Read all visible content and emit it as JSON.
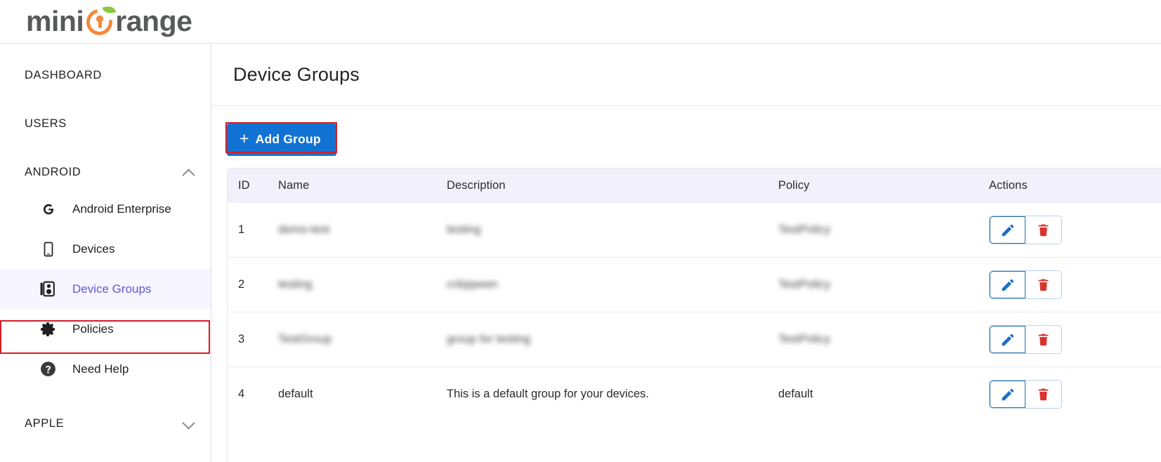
{
  "brand": {
    "logo_text_1": "mini",
    "logo_text_2": "range",
    "logo_alt": "miniOrange",
    "orange_hex": "#f6883a",
    "leaf_hex": "#8dc63f",
    "text_hex": "#58595b"
  },
  "sidebar": {
    "sections": [
      {
        "label": "DASHBOARD",
        "expandable": false,
        "chevron": ""
      },
      {
        "label": "USERS",
        "expandable": false,
        "chevron": ""
      },
      {
        "label": "ANDROID",
        "expandable": true,
        "chevron": "chevron-up-icon"
      },
      {
        "label": "APPLE",
        "expandable": true,
        "chevron": "chevron-down-icon"
      }
    ],
    "android_items": [
      {
        "label": "Android Enterprise",
        "icon": "google-g-icon",
        "active": false
      },
      {
        "label": "Devices",
        "icon": "mobile-device-icon",
        "active": false
      },
      {
        "label": "Device Groups",
        "icon": "device-groups-icon",
        "active": true
      },
      {
        "label": "Policies",
        "icon": "gear-icon",
        "active": false
      },
      {
        "label": "Need Help",
        "icon": "question-circle-icon",
        "active": false
      }
    ],
    "active_item": "Device Groups",
    "active_color": "#5b5bd6",
    "active_bg": "#f7f5ff"
  },
  "main": {
    "page_title": "Device Groups",
    "add_button": {
      "label": "Add Group",
      "plus_glyph": "+",
      "bg_hex": "#1272d3",
      "text_hex": "#ffffff"
    }
  },
  "table": {
    "header_bg_hex": "#f2f0fa",
    "columns": [
      "ID",
      "Name",
      "Description",
      "Policy",
      "Actions"
    ],
    "rows": [
      {
        "id": "1",
        "name": "demo-test",
        "description": "testing",
        "policy": "TestPolicy",
        "redacted": true,
        "actions": [
          "edit-icon",
          "delete-icon"
        ]
      },
      {
        "id": "2",
        "name": "testing",
        "description": "cnbjqwwn",
        "policy": "TestPolicy",
        "redacted": true,
        "actions": [
          "edit-icon",
          "delete-icon"
        ]
      },
      {
        "id": "3",
        "name": "TestGroup",
        "description": "group for testing",
        "policy": "TestPolicy",
        "redacted": true,
        "actions": [
          "edit-icon",
          "delete-icon"
        ]
      },
      {
        "id": "4",
        "name": "default",
        "description": "This is a default group for your devices.",
        "policy": "default",
        "redacted": false,
        "actions": [
          "edit-icon",
          "delete-icon"
        ]
      }
    ],
    "edit_icon_color": "#1b6fc4",
    "delete_icon_color": "#d8332f"
  },
  "annotations": {
    "highlight_color": "#d01f26",
    "highlight_targets": [
      "sidebar-item-device-groups",
      "add-group-button"
    ]
  }
}
